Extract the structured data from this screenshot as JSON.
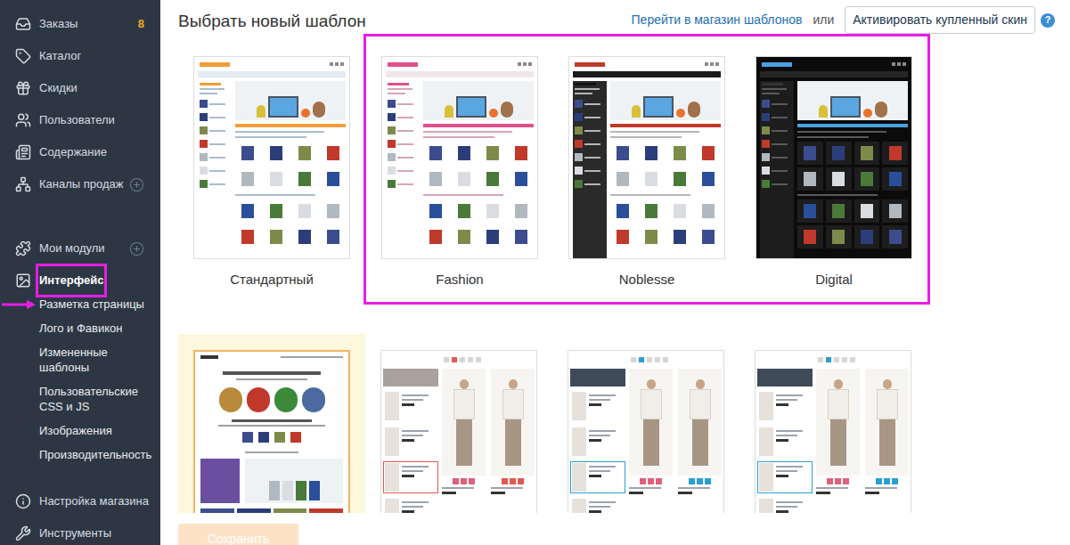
{
  "sidebar": {
    "groups": [
      [
        {
          "label": "Заказы",
          "badge": "8",
          "add": false,
          "selected": false,
          "annotated": false,
          "expanded": false
        },
        {
          "label": "Каталог",
          "add": false,
          "selected": false,
          "annotated": false,
          "expanded": false
        },
        {
          "label": "Скидки",
          "add": false,
          "selected": false,
          "annotated": false,
          "expanded": false
        },
        {
          "label": "Пользователи",
          "add": false,
          "selected": false,
          "annotated": false,
          "expanded": false
        },
        {
          "label": "Содержание",
          "add": false,
          "selected": false,
          "annotated": false,
          "expanded": false
        },
        {
          "label": "Каналы продаж",
          "add": true,
          "selected": false,
          "annotated": false,
          "expanded": false
        }
      ],
      [
        {
          "label": "Мои модули",
          "add": true,
          "selected": false,
          "annotated": false,
          "expanded": false
        },
        {
          "label": "Интерфейс",
          "add": false,
          "selected": true,
          "annotated": true,
          "expanded": true,
          "subitems": [
            {
              "label": "Разметка страницы",
              "annotated": true
            },
            {
              "label": "Лого и Фавикон",
              "annotated": false
            },
            {
              "label": "Измененные шаблоны",
              "annotated": false
            },
            {
              "label": "Пользовательские CSS и JS",
              "annotated": false
            },
            {
              "label": "Изображения",
              "annotated": false
            },
            {
              "label": "Производительность",
              "annotated": false
            }
          ]
        }
      ],
      [
        {
          "label": "Настройка магазина",
          "add": false,
          "selected": false,
          "annotated": false,
          "expanded": false
        },
        {
          "label": "Инструменты",
          "add": false,
          "selected": false,
          "annotated": false,
          "expanded": false
        }
      ]
    ]
  },
  "header": {
    "title": "Выбрать новый шаблон",
    "store_link": "Перейти в магазин шаблонов",
    "or": "или",
    "activate_button": "Активировать купленный скин",
    "help": "?"
  },
  "template_rows": [
    [
      {
        "label": "Стандартный",
        "kind": "standard",
        "selected": false,
        "annotated": false
      },
      {
        "label": "Fashion",
        "kind": "fashion",
        "selected": false,
        "annotated": true
      },
      {
        "label": "Noblesse",
        "kind": "noblesse",
        "selected": false,
        "annotated": true
      },
      {
        "label": "Digital",
        "kind": "digital",
        "selected": false,
        "annotated": true
      }
    ],
    [
      {
        "kind": "comic",
        "selected": true,
        "annotated": false
      },
      {
        "kind": "sale-light",
        "selected": false,
        "annotated": false
      },
      {
        "kind": "sale-dark",
        "selected": false,
        "annotated": false
      },
      {
        "kind": "sale-dark",
        "selected": false,
        "annotated": false
      }
    ]
  ],
  "save_button": {
    "label": "Сохранить",
    "disabled": true
  }
}
